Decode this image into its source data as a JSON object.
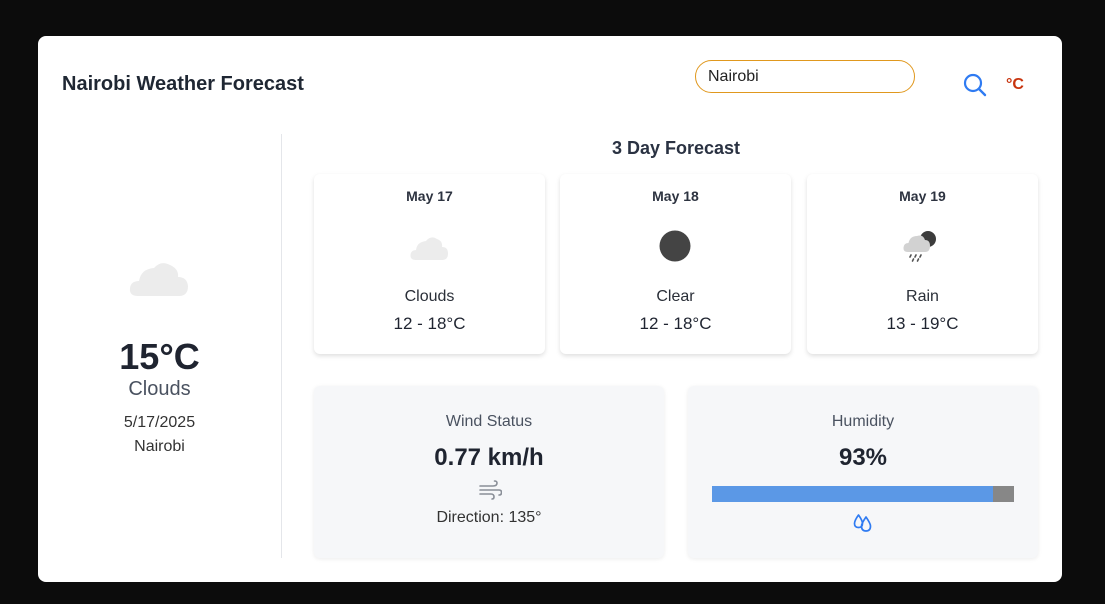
{
  "header": {
    "title": "Nairobi Weather Forecast",
    "search": {
      "value": "Nairobi",
      "placeholder": ""
    },
    "search_icon": "search-icon",
    "unit_label": "°C"
  },
  "current": {
    "icon": "clouds-icon",
    "temperature": "15°C",
    "condition": "Clouds",
    "date": "5/17/2025",
    "city": "Nairobi"
  },
  "forecast": {
    "title": "3 Day Forecast",
    "days": [
      {
        "date": "May 17",
        "icon": "clouds-icon",
        "condition": "Clouds",
        "range": "12 - 18°C"
      },
      {
        "date": "May 18",
        "icon": "clear-icon",
        "condition": "Clear",
        "range": "12 - 18°C"
      },
      {
        "date": "May 19",
        "icon": "rain-icon",
        "condition": "Rain",
        "range": "13 - 19°C"
      }
    ]
  },
  "wind": {
    "label": "Wind Status",
    "value": "0.77 km/h",
    "icon": "wind-icon",
    "direction": "Direction: 135°"
  },
  "humidity": {
    "label": "Humidity",
    "value": "93%",
    "percent": 93,
    "icon": "water-drop-icon"
  },
  "colors": {
    "page_background": "#0c0c0c",
    "card_background": "#ffffff",
    "search_border": "#e0981e",
    "search_icon": "#2f7bf2",
    "unit_toggle": "#c8340e",
    "humidity_fill": "#5b98e6",
    "humidity_track": "#878787"
  }
}
